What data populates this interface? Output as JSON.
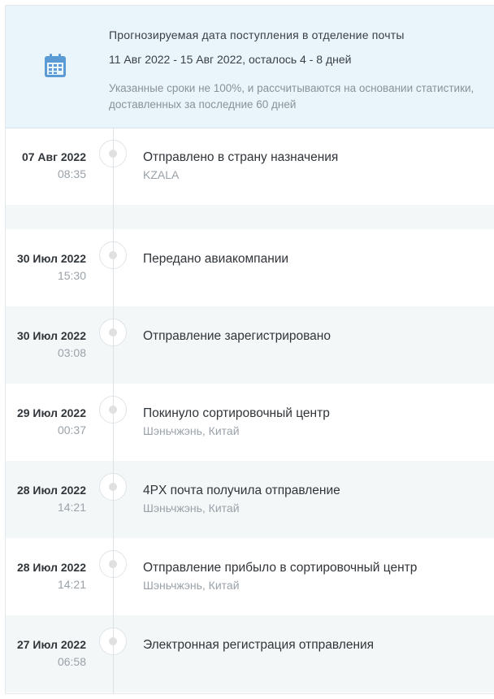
{
  "estimate": {
    "icon": "calendar-icon",
    "accent": "#5b9bd5",
    "title": "Прогнозируемая дата поступления в отделение почты",
    "range": "11 Авг 2022 - 15 Авг 2022, осталось 4 - 8 дней",
    "note": "Указанные сроки не 100%, и рассчитываются на основании статистики, доставленных за последние 60 дней"
  },
  "events": [
    {
      "date": "07 Авг 2022",
      "time": "08:35",
      "status": "Отправлено в страну назначения",
      "location": "KZALA"
    },
    {
      "date": "30 Июл 2022",
      "time": "15:30",
      "status": "Передано авиакомпании",
      "location": ""
    },
    {
      "date": "30 Июл 2022",
      "time": "03:08",
      "status": "Отправление зарегистрировано",
      "location": ""
    },
    {
      "date": "29 Июл 2022",
      "time": "00:37",
      "status": "Покинуло сортировочный центр",
      "location": "Шэньчжэнь, Китай"
    },
    {
      "date": "28 Июл 2022",
      "time": "14:21",
      "status": "4PX почта получила отправление",
      "location": "Шэньчжэнь, Китай"
    },
    {
      "date": "28 Июл 2022",
      "time": "14:21",
      "status": "Отправление прибыло в сортировочный центр",
      "location": "Шэньчжэнь, Китай"
    },
    {
      "date": "27 Июл 2022",
      "time": "06:58",
      "status": "Электронная регистрация отправления",
      "location": ""
    }
  ]
}
